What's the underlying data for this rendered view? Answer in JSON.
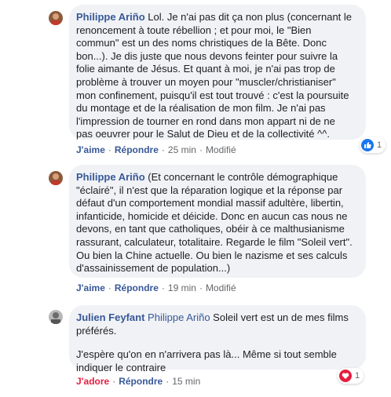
{
  "comments": [
    {
      "author": "Philippe Ariño",
      "text": "Lol. Je n'ai pas dit ça non plus (concernant le\nrenoncement à toute rébellion ; et pour moi, le \"Bien\ncommun\" est un des noms christiques de la Bête. Donc\nbon...). Je dis juste que nous devons feinter pour suivre la\nfolie aimante de Jésus. Et quant à moi, je n'ai pas trop de\nproblème à trouver un moyen pour \"muscler/christianiser\"\nmon confinement, puisqu'il est tout trouvé : c'est la poursuite\ndu montage et de la réalisation de mon film. Je n'ai pas\nl'impression de tourner en rond dans mon appart ni de ne\npas oeuvrer pour le Salut de Dieu et de la collectivité ^^.",
      "like_label": "J'aime",
      "reply_label": "Répondre",
      "time": "25 min",
      "edited": "Modifié",
      "reaction_count": "1"
    },
    {
      "author": "Philippe Ariño",
      "text": "(Et concernant le contrôle démographique\n\"éclairé\", il n'est que la réparation logique et la réponse par\ndéfaut d'un comportement mondial massif adultère, libertin,\ninfanticide, homicide et déicide. Donc en aucun cas nous ne\ndevons, en tant que catholiques, obéir à ce malthusianisme\nrassurant, calculateur, totalitaire. Regarde le film \"Soleil vert\".\nOu bien la Chine actuelle. Ou bien le nazisme et ses calculs\nd'assainissement de population...)",
      "like_label": "J'aime",
      "reply_label": "Répondre",
      "time": "19 min",
      "edited": "Modifié"
    },
    {
      "author": "Julien Feyfant",
      "mention": "Philippe Ariño",
      "text": "Soleil vert est un de mes films\npréférés.",
      "text2": "J'espère qu'on en n'arrivera pas là... Même si tout semble\nindiquer le contraire",
      "like_label": "J'adore",
      "reply_label": "Répondre",
      "time": "15 min",
      "reaction_count": "1"
    }
  ],
  "colors": {
    "link": "#385898",
    "bubble": "#f0f2f5",
    "love": "#e41e3f",
    "like": "#1877f2"
  },
  "icons": [
    "avatar-philippe",
    "avatar-julien",
    "like-reaction-icon",
    "love-reaction-icon"
  ]
}
